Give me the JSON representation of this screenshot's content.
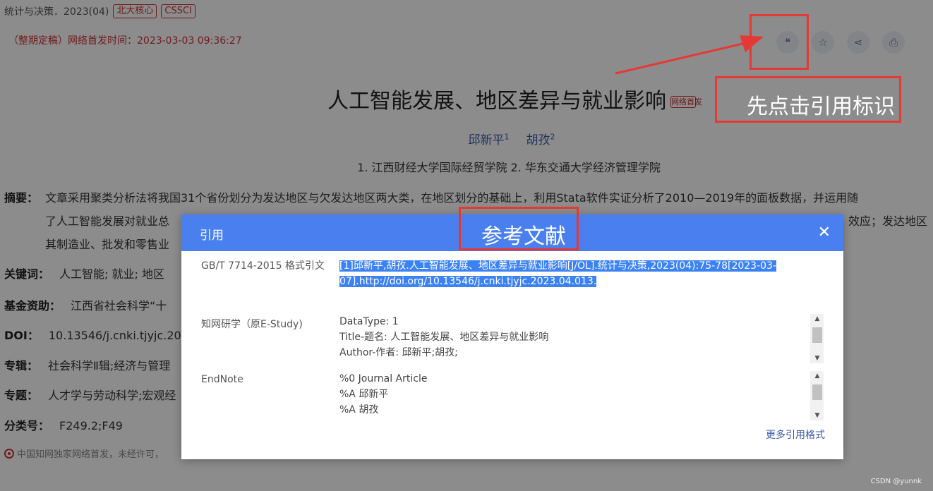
{
  "journal": {
    "name": "统计与决策．2023(04)",
    "badges": [
      "北大核心",
      "CSSCI"
    ]
  },
  "pub_info": "（整期定稿）网络首发时间：2023-03-03 09:36:27",
  "toolbar": {
    "icons": [
      "quote-icon",
      "star-icon",
      "share-icon",
      "print-icon"
    ]
  },
  "article": {
    "title": "人工智能发展、地区差异与就业影响",
    "title_badge": "网络首发",
    "authors": [
      {
        "name": "邱新平",
        "sup": "1"
      },
      {
        "name": "胡孜",
        "sup": "2"
      }
    ],
    "affiliations": "1. 江西财经大学国际经贸学院   2. 华东交通大学经济管理学院"
  },
  "fields": {
    "abstract_label": "摘要：",
    "abstract_line1": "文章采用聚类分析法将我国31个省份划分为发达地区与欠发达地区两大类，在地区划分的基础上，利用Stata软件实证分析了2010—2019年的面板数据，并运用随",
    "abstract_line2": "了人工智能发展对就业总",
    "abstract_line2_tail": "效应；发达地区",
    "abstract_line3": "其制造业、批发和零售业",
    "keywords_label": "关键词：",
    "keywords_value": "人工智能;  就业;  地区",
    "fund_label": "基金资助：",
    "fund_value": "江西省社会科学“十",
    "doi_label": "DOI：",
    "doi_value": "10.13546/j.cnki.tjyjc.202",
    "series_label": "专辑：",
    "series_value": "社会科学Ⅱ辑;经济与管理",
    "topic_label": "专题：",
    "topic_value": "人才学与劳动科学;宏观经",
    "class_label": "分类号：",
    "class_value": "F249.2;F49"
  },
  "footnote": "中国知网独家网络首发，未经许可，",
  "modal": {
    "title": "引用",
    "close": "✕",
    "gbt_label": "GB/T 7714-2015 格式引文",
    "gbt_citation_1": "[1]邱新平,胡孜.人工智能发展、地区差异与就业影响[J/OL].统计与决策,2023(04):75-78[2023-03-",
    "gbt_citation_2": "07].http://doi.org/10.13546/j.cnki.tjyjc.2023.04.013.",
    "estudy_label": "知网研学（原E-Study)",
    "estudy_lines": [
      "DataType: 1",
      "Title-题名: 人工智能发展、地区差异与就业影响",
      "Author-作者: 邱新平;胡孜;"
    ],
    "endnote_label": "EndNote",
    "endnote_lines": [
      "%0 Journal Article",
      "%A 邱新平",
      "%A 胡孜"
    ],
    "more_formats": "更多引用格式"
  },
  "annotations": {
    "step_text": "先点击引用标识",
    "modal_text": "参考文献",
    "color": "#e53935"
  },
  "watermark": "CSDN @yunnk"
}
